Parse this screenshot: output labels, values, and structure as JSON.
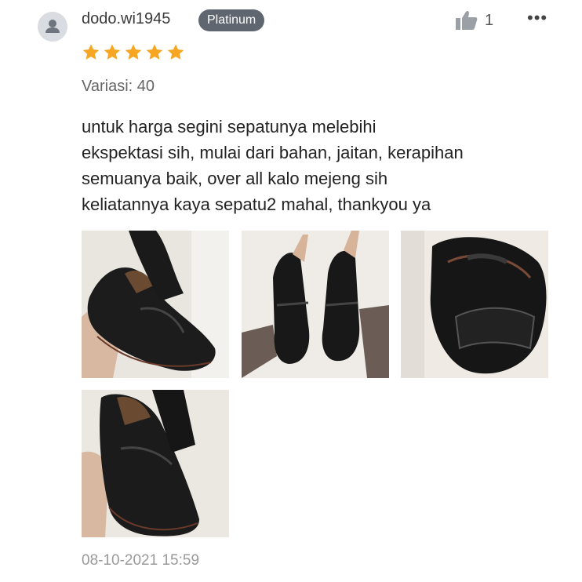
{
  "review": {
    "username": "dodo.wi1945",
    "badge": "Platinum",
    "like_count": "1",
    "rating": 5,
    "variant": "Variasi: 40",
    "comment": "untuk harga segini sepatunya melebihi\nekspektasi sih, mulai dari bahan, jaitan, kerapihan\nsemuanya baik, over all kalo mejeng sih\nkeliatannya kaya sepatu2 mahal, thankyou ya",
    "timestamp": "08-10-2021 15:59",
    "photos": [
      "shoe-photo",
      "shoe-photo",
      "shoe-photo",
      "shoe-photo"
    ]
  },
  "colors": {
    "star": "#f6a623",
    "badge_bg": "#5f6670",
    "avatar_bg": "#d9dce1",
    "timestamp": "#9a9a9a"
  },
  "icons": {
    "avatar": "user-icon",
    "like": "thumbs-up-icon",
    "more": "more-icon",
    "star": "star-icon"
  }
}
